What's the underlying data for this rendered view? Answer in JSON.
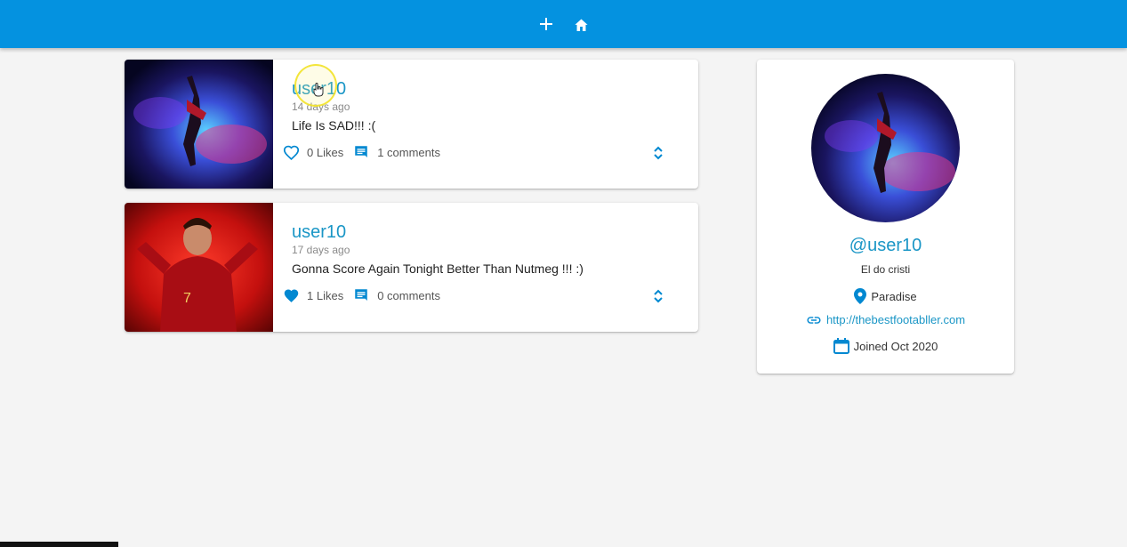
{
  "nav": {
    "add_icon": "plus-icon",
    "home_icon": "home-icon"
  },
  "posts": [
    {
      "user": "user10",
      "date": "14 days ago",
      "text": "Life Is SAD!!! :(",
      "likes": "0 Likes",
      "comments": "1 comments",
      "liked": false
    },
    {
      "user": "user10",
      "date": "17 days ago",
      "text": "Gonna Score Again Tonight Better Than Nutmeg !!! :)",
      "likes": "1 Likes",
      "comments": "0 comments",
      "liked": true
    }
  ],
  "profile": {
    "handle": "@user10",
    "bio": "El do cristi",
    "location": "Paradise",
    "website": "http://thebestfootabller.com",
    "joined": "Joined Oct 2020"
  },
  "colors": {
    "appbar": "#0492e0",
    "accent": "#1a96c6",
    "icon": "#0288d1"
  }
}
